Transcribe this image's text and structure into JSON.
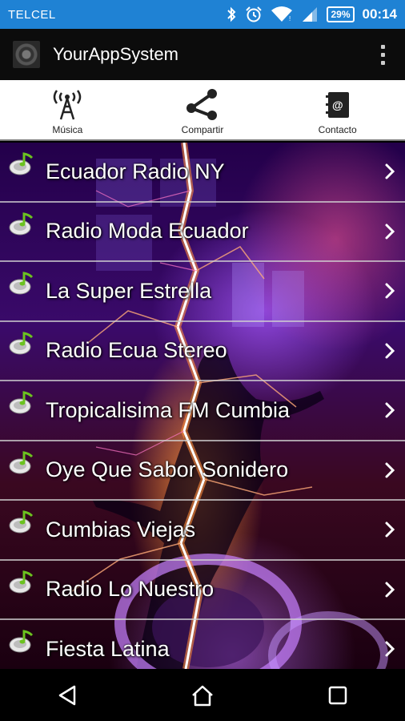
{
  "status_bar": {
    "carrier": "TELCEL",
    "battery": "29%",
    "time": "00:14",
    "icons": [
      "bluetooth-icon",
      "alarm-icon",
      "wifi-icon",
      "signal-icon",
      "battery-icon"
    ]
  },
  "app_bar": {
    "title": "YourAppSystem",
    "icon": "app-logo-icon",
    "overflow_icon": "overflow-menu-icon"
  },
  "tabs": [
    {
      "label": "Música",
      "icon": "radio-antenna-icon"
    },
    {
      "label": "Compartir",
      "icon": "share-icon"
    },
    {
      "label": "Contacto",
      "icon": "contact-book-icon"
    }
  ],
  "stations": [
    {
      "label": "Ecuador Radio NY"
    },
    {
      "label": "Radio Moda Ecuador"
    },
    {
      "label": "La Super Estrella"
    },
    {
      "label": "Radio Ecua Stereo"
    },
    {
      "label": "Tropicalisima FM Cumbia"
    },
    {
      "label": "Oye Que Sabor Sonidero"
    },
    {
      "label": "Cumbias Viejas"
    },
    {
      "label": "Radio Lo Nuestro"
    },
    {
      "label": "Fiesta Latina"
    }
  ],
  "nav_bar": {
    "icons": [
      "back-icon",
      "home-icon",
      "recents-icon"
    ]
  },
  "colors": {
    "status_bar": "#1f82d4",
    "app_bar": "#0c0c0c",
    "tab_bar": "#ffffff",
    "row_divider": "#d2d2d2",
    "list_text": "#ffffff"
  }
}
